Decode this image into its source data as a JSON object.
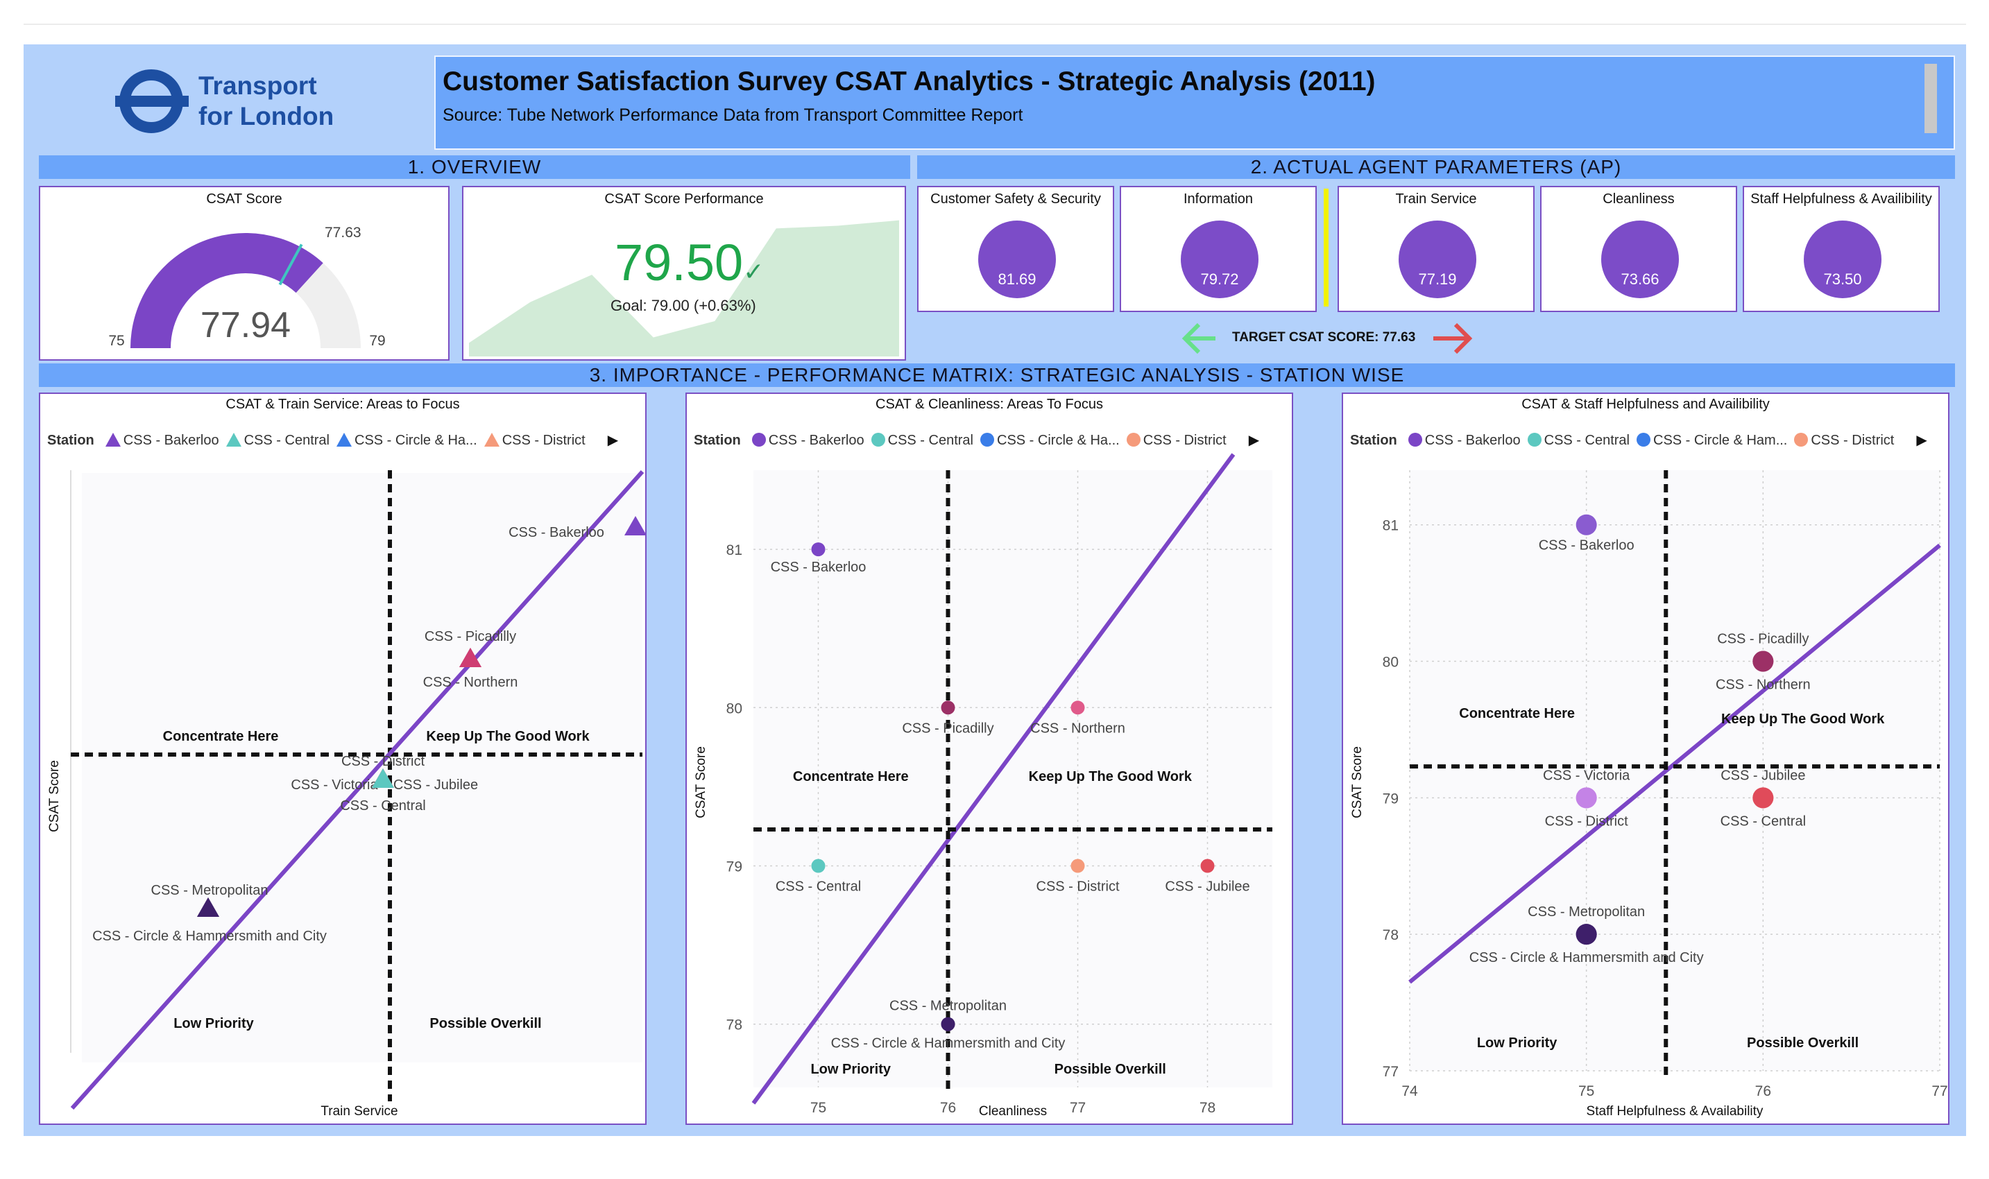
{
  "header": {
    "logo_line1": "Transport",
    "logo_line2": "for London",
    "title": "Customer Satisfaction Survey CSAT Analytics - Strategic Analysis (2011)",
    "subtitle": "Source: Tube Network Performance Data from Transport Committee Report"
  },
  "sections": {
    "overview": "1. OVERVIEW",
    "ap": "2. ACTUAL AGENT PARAMETERS (AP)",
    "matrix": "3. IMPORTANCE - PERFORMANCE MATRIX: STRATEGIC ANALYSIS - STATION WISE"
  },
  "gauge": {
    "title": "CSAT Score",
    "value": "77.94",
    "value_num": 77.94,
    "min": "75",
    "min_num": 75,
    "max": "79",
    "max_num": 79,
    "target": "77.63",
    "target_num": 77.63
  },
  "performance": {
    "title": "CSAT Score Performance",
    "value": "79.50",
    "check": "✓",
    "goal": "Goal: 79.00 (+0.63%)",
    "trend": [
      75,
      76.5,
      77.5,
      75.2,
      75.8,
      79.2,
      79.3,
      79.5
    ]
  },
  "ap_cards": [
    {
      "label": "Customer Safety & Security",
      "value": "81.69"
    },
    {
      "label": "Information",
      "value": "79.72"
    },
    {
      "label": "Train Service",
      "value": "77.19"
    },
    {
      "label": "Cleanliness",
      "value": "73.66"
    },
    {
      "label": "Staff Helpfulness & Availibility",
      "value": "73.50"
    }
  ],
  "target_label": "TARGET CSAT SCORE: 77.63",
  "colors": {
    "accent": "#7c4cc8",
    "board": "#b3d1fb",
    "header": "#6ba5fa",
    "gauge_fill": "#7b45c6",
    "green": "#1fa64a",
    "arrow_left": "#67e08a",
    "arrow_right": "#e04e4e"
  },
  "legend": {
    "field": "Station",
    "items": [
      "CSS - Bakerloo",
      "CSS - Central",
      "CSS - Circle & Ha...",
      "CSS - District"
    ],
    "items_alt": [
      "CSS - Bakerloo",
      "CSS - Central",
      "CSS - Circle & Ham...",
      "CSS - District"
    ],
    "colors": [
      "#7b45c6",
      "#5cc8c0",
      "#3a7de8",
      "#f59a7a"
    ],
    "more": "▶"
  },
  "quadrants": {
    "tl": "Concentrate Here",
    "tr": "Keep Up The Good Work",
    "bl": "Low Priority",
    "br": "Possible Overkill"
  },
  "chart_data": [
    {
      "type": "scatter",
      "title": "CSAT & Train Service: Areas to Focus",
      "xlabel": "Train Service",
      "ylabel": "CSAT Score",
      "marker": "triangle",
      "axis_ticks": false,
      "points": [
        {
          "label": "CSS - Bakerloo",
          "color": "#7b45c6"
        },
        {
          "label": "CSS - Picadilly",
          "color": "#9c3066"
        },
        {
          "label": "CSS - Northern",
          "color": "#cf3d72"
        },
        {
          "label": "CSS - District",
          "color": "#f59a7a"
        },
        {
          "label": "CSS - Victoria",
          "color": "#c483e6"
        },
        {
          "label": "CSS - Jubilee",
          "color": "#e04b5a"
        },
        {
          "label": "CSS - Central",
          "color": "#5cc8c0"
        },
        {
          "label": "CSS - Metropolitan",
          "color": "#55307e"
        },
        {
          "label": "CSS - Circle & Hammersmith and City",
          "color": "#3e1f6a"
        }
      ]
    },
    {
      "type": "scatter",
      "title": "CSAT & Cleanliness: Areas To Focus",
      "xlabel": "Cleanliness",
      "ylabel": "CSAT Score",
      "marker": "circle",
      "xlim": [
        74.5,
        78.5
      ],
      "ylim": [
        77.6,
        81.5
      ],
      "xticks": [
        75,
        76,
        77,
        78
      ],
      "yticks": [
        78,
        79,
        80,
        81
      ],
      "quadrant_x": 76,
      "quadrant_y": 79.23,
      "trend": [
        [
          74.5,
          77.5
        ],
        [
          78.2,
          81.6
        ]
      ],
      "points": [
        {
          "label": "CSS - Bakerloo",
          "x": 75,
          "y": 81,
          "color": "#7b45c6"
        },
        {
          "label": "CSS - Picadilly",
          "x": 76,
          "y": 80,
          "color": "#9c3066"
        },
        {
          "label": "CSS - Northern",
          "x": 77,
          "y": 80,
          "color": "#e05a8a"
        },
        {
          "label": "CSS - Central",
          "x": 75,
          "y": 79,
          "color": "#5cc8c0"
        },
        {
          "label": "CSS - District",
          "x": 77,
          "y": 79,
          "color": "#f59a7a"
        },
        {
          "label": "CSS - Jubilee",
          "x": 78,
          "y": 79,
          "color": "#e04b5a"
        },
        {
          "label": "CSS - Metropolitan",
          "x": 76,
          "y": 78,
          "color": "#3e1f6a"
        },
        {
          "label": "CSS - Circle & Hammersmith and City",
          "x": 76,
          "y": 78,
          "color": "#3e1f6a"
        }
      ]
    },
    {
      "type": "scatter",
      "title": "CSAT & Staff Helpfulness and Availibility",
      "xlabel": "Staff Helpfulness & Availability",
      "ylabel": "CSAT Score",
      "marker": "circle",
      "xlim": [
        74,
        77
      ],
      "ylim": [
        77,
        81.4
      ],
      "xticks": [
        74,
        75,
        76,
        77
      ],
      "yticks": [
        77,
        78,
        79,
        80,
        81
      ],
      "quadrant_x": 75.45,
      "quadrant_y": 79.23,
      "trend": [
        [
          74,
          77.65
        ],
        [
          77,
          80.85
        ]
      ],
      "points": [
        {
          "label": "CSS - Bakerloo",
          "x": 75,
          "y": 81,
          "color": "#8a5cd0"
        },
        {
          "label": "CSS - Picadilly",
          "x": 76,
          "y": 80,
          "color": "#9c3066"
        },
        {
          "label": "CSS - Northern",
          "x": 76,
          "y": 80,
          "color": "#9c3066"
        },
        {
          "label": "CSS - Victoria",
          "x": 75,
          "y": 79,
          "color": "#c483e6"
        },
        {
          "label": "CSS - District",
          "x": 75,
          "y": 79,
          "color": "#c483e6"
        },
        {
          "label": "CSS - Jubilee",
          "x": 76,
          "y": 79,
          "color": "#e04b5a"
        },
        {
          "label": "CSS - Central",
          "x": 76,
          "y": 79,
          "color": "#e04b5a"
        },
        {
          "label": "CSS - Metropolitan",
          "x": 75,
          "y": 78,
          "color": "#3e1f6a"
        },
        {
          "label": "CSS - Circle & Hammersmith and City",
          "x": 75,
          "y": 78,
          "color": "#3e1f6a"
        }
      ]
    }
  ]
}
